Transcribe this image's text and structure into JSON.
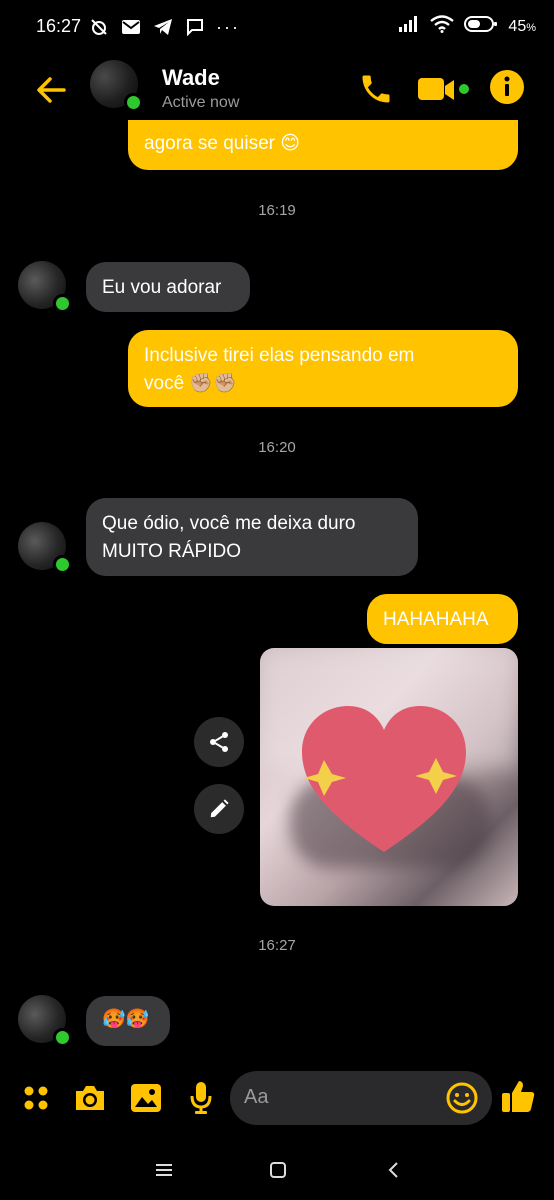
{
  "status_bar": {
    "time": "16:27",
    "dots": "···",
    "battery": "45"
  },
  "header": {
    "contact_name": "Wade",
    "presence": "Active now"
  },
  "messages": [
    {
      "id": "m1",
      "side": "out",
      "text": "agora se quiser 😊"
    },
    {
      "id": "t1",
      "type": "timestamp",
      "text": "16:19"
    },
    {
      "id": "m2",
      "side": "in",
      "text": "Eu vou adorar"
    },
    {
      "id": "m3",
      "side": "out",
      "text_line1": "Inclusive tirei elas pensando em",
      "text_line2": "você ✊🏼✊🏼"
    },
    {
      "id": "t2",
      "type": "timestamp",
      "text": "16:20"
    },
    {
      "id": "m4",
      "side": "in",
      "text_line1": "Que ódio, você me deixa duro",
      "text_line2": "MUITO RÁPIDO"
    },
    {
      "id": "m5",
      "side": "out",
      "text": "HAHAHAHA"
    },
    {
      "id": "m6",
      "side": "out",
      "type": "photo"
    },
    {
      "id": "t3",
      "type": "timestamp",
      "text": "16:27"
    },
    {
      "id": "m7",
      "side": "in",
      "text": "🥵🥵"
    }
  ],
  "composer": {
    "placeholder": "Aa"
  },
  "colors": {
    "accent": "#ffc300",
    "incoming_bubble": "#3a3a3c",
    "online": "#2fc82f"
  }
}
